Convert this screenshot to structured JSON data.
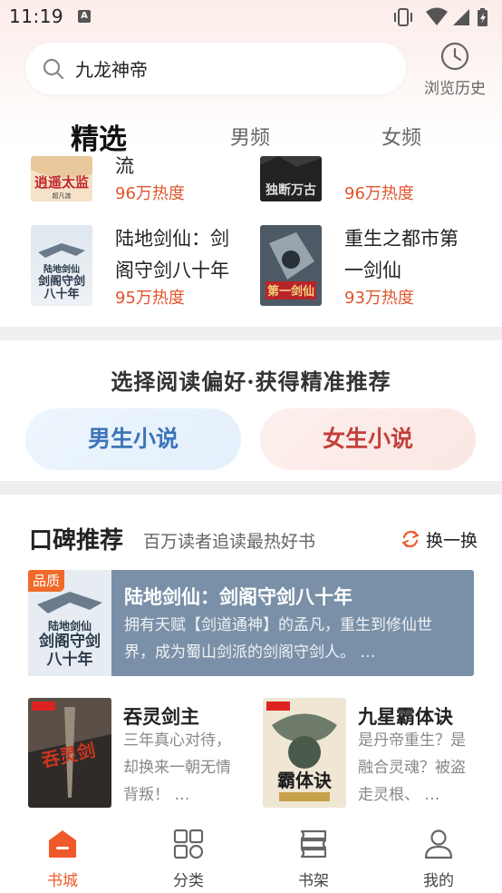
{
  "status": {
    "time": "11:19",
    "notification_icon": "A"
  },
  "search": {
    "query": "九龙神帝"
  },
  "history": {
    "label": "浏览历史"
  },
  "tabs": [
    {
      "label": "精选",
      "active": true
    },
    {
      "label": "男频",
      "active": false
    },
    {
      "label": "女频",
      "active": false
    }
  ],
  "top_books": [
    {
      "title_tail": "流",
      "heat": "96万热度"
    },
    {
      "title_tail": "",
      "heat": "96万热度"
    },
    {
      "title": "陆地剑仙：剑阁守剑八十年",
      "heat": "95万热度"
    },
    {
      "title": "重生之都市第一剑仙",
      "heat": "93万热度"
    }
  ],
  "preference": {
    "title": "选择阅读偏好·获得精准推荐",
    "male": "男生小说",
    "female": "女生小说"
  },
  "reputation": {
    "title": "口碑推荐",
    "subtitle": "百万读者追读最热好书",
    "swap": "换一换",
    "featured": {
      "badge": "品质",
      "title": "陆地剑仙：剑阁守剑八十年",
      "desc": "拥有天赋【剑道通神】的孟凡，重生到修仙世界，成为蜀山剑派的剑阁守剑人。 …"
    },
    "books": [
      {
        "title": "吞灵剑主",
        "desc": "三年真心对待，却换来一朝无情背叛！ …"
      },
      {
        "title": "九星霸体诀",
        "desc": "是丹帝重生？是融合灵魂？被盗走灵根、 …"
      }
    ]
  },
  "nav": [
    {
      "label": "书城",
      "icon": "home-icon",
      "active": true
    },
    {
      "label": "分类",
      "icon": "category-icon",
      "active": false
    },
    {
      "label": "书架",
      "icon": "bookshelf-icon",
      "active": false
    },
    {
      "label": "我的",
      "icon": "profile-icon",
      "active": false
    }
  ],
  "colors": {
    "accent": "#f0592a",
    "heat": "#e0552c",
    "male": "#3d74b8",
    "female": "#c2403a"
  }
}
